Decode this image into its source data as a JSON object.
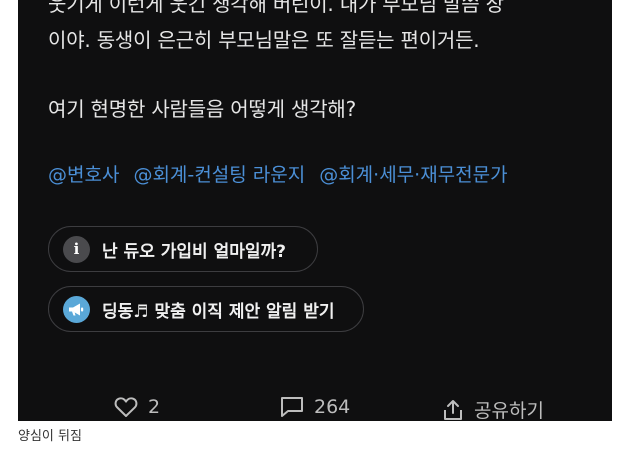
{
  "post": {
    "body_line_cut": "웃기게 이런게 웃긴 생각해 버린이. 내가 부모님 말씀 장",
    "body_line_2": "이야. 동생이 은근히 부모님말은 또 잘듣는 편이거든.",
    "body_line_3": "여기 현명한 사람들음 어떻게 생각해?",
    "tags": [
      "@변호사",
      "@회계-컨설팅 라운지",
      "@회계·세무·재무전문가"
    ]
  },
  "pills": {
    "subscription_question": "난 듀오 가입비 얼마일까?",
    "job_alert": "딩동♬ 맞춤 이직 제안 알림 받기"
  },
  "actions": {
    "like_count": "2",
    "comment_count": "264",
    "share_label": "공유하기"
  },
  "caption": "양심이 뒤짐",
  "icons": {
    "info": "info-icon",
    "megaphone": "megaphone-icon",
    "like": "heart-icon",
    "comment": "comment-icon",
    "share": "share-icon"
  },
  "colors": {
    "background": "#0f0f10",
    "tag_link": "#4b8fd6",
    "megaphone_badge": "#5aa8d8"
  }
}
